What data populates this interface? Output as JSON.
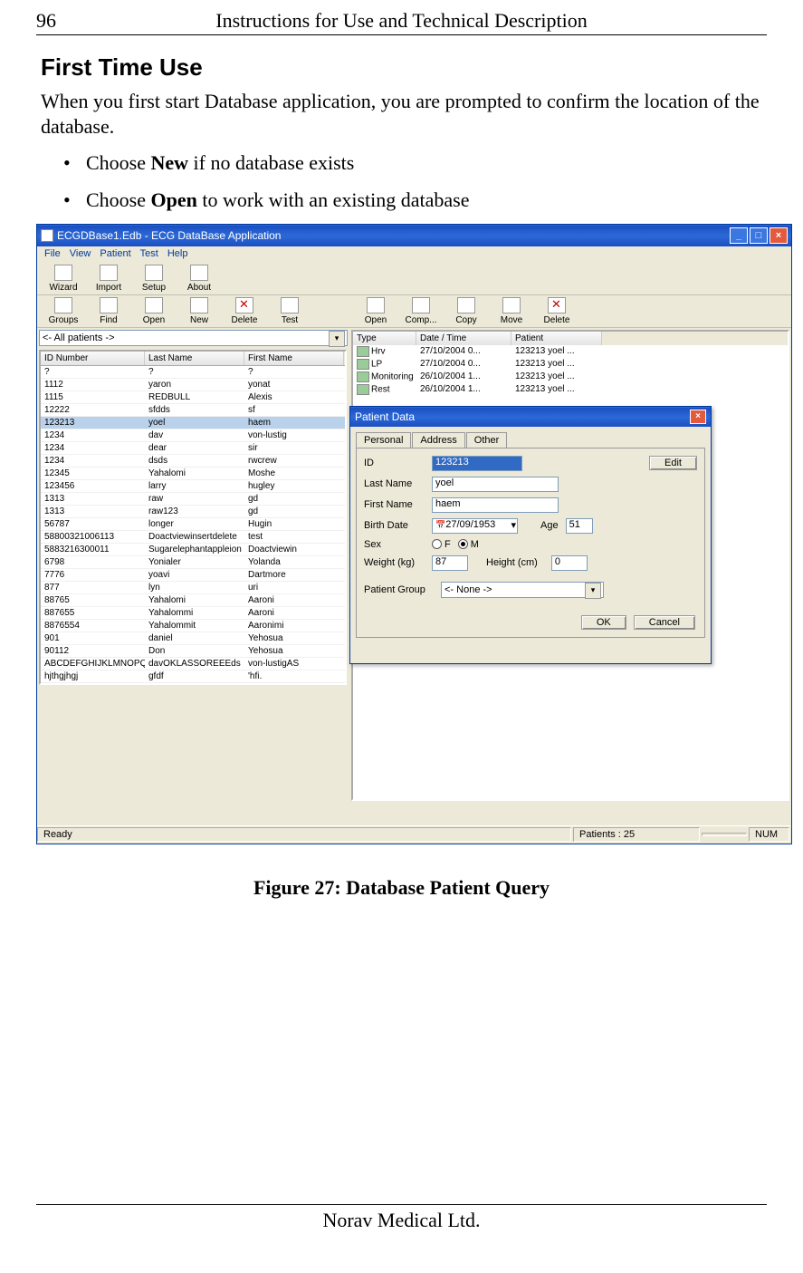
{
  "doc": {
    "page_number": "96",
    "running_head": "Instructions for Use and Technical Description",
    "section_heading": "First Time Use",
    "intro": "When you first start Database application, you are prompted to confirm the location of the database.",
    "bullets": [
      {
        "pre": "Choose ",
        "bold": "New",
        "post": " if no database exists"
      },
      {
        "pre": "Choose ",
        "bold": "Open",
        "post": " to work with an existing database"
      }
    ],
    "figure_caption": "Figure 27: Database Patient Query",
    "footer": "Norav Medical Ltd."
  },
  "app": {
    "title": "ECGDBase1.Edb - ECG DataBase Application",
    "menus": [
      "File",
      "View",
      "Patient",
      "Test",
      "Help"
    ],
    "toolbar1": [
      "Wizard",
      "Import",
      "Setup",
      "About"
    ],
    "toolbar2": [
      "Groups",
      "Find",
      "Open",
      "New",
      "Delete",
      "Test"
    ],
    "combo_value": "<- All patients ->",
    "left_headers": [
      "ID Number",
      "Last Name",
      "First Name"
    ],
    "left_rows": [
      [
        "?",
        "?",
        "?"
      ],
      [
        "1112",
        "yaron",
        "yonat"
      ],
      [
        "1115",
        "REDBULL",
        "Alexis"
      ],
      [
        "12222",
        "sfdds",
        "sf"
      ],
      [
        "123213",
        "yoel",
        "haem"
      ],
      [
        "1234",
        "dav",
        "von-lustig"
      ],
      [
        "1234",
        "dear",
        "sir"
      ],
      [
        "1234",
        "dsds",
        "rwcrew"
      ],
      [
        "12345",
        "Yahalomi",
        "Moshe"
      ],
      [
        "123456",
        "larry",
        "hugley"
      ],
      [
        "1313",
        "raw",
        "gd"
      ],
      [
        "1313",
        "raw123",
        "gd"
      ],
      [
        "56787",
        "longer",
        "Hugin"
      ],
      [
        "58800321006113",
        "Doactviewinsertdelete",
        "test"
      ],
      [
        "5883216300011",
        "Sugarelephantappleion",
        "Doactviewin"
      ],
      [
        "6798",
        "Yonialer",
        "Yolanda"
      ],
      [
        "7776",
        "yoavi",
        "Dartmore"
      ],
      [
        "877",
        "lyn",
        "uri"
      ],
      [
        "88765",
        "Yahalomi",
        "Aaroni"
      ],
      [
        "887655",
        "Yahalommi",
        "Aaroni"
      ],
      [
        "8876554",
        "Yahalommit",
        "Aaronimi"
      ],
      [
        "901",
        "daniel",
        "Yehosua"
      ],
      [
        "90112",
        "Don",
        "Yehosua"
      ],
      [
        "ABCDEFGHIJKLMNOPQ...",
        "davOKLASSOREEEds",
        "von-lustigAS"
      ],
      [
        "hjthgjhgj",
        "gfdf",
        "'hfi."
      ]
    ],
    "selected_row_index": 4,
    "right_toolbar": [
      "Open",
      "Comp...",
      "Copy",
      "Move",
      "Delete"
    ],
    "right_headers": [
      "Type",
      "Date / Time",
      "Patient"
    ],
    "right_rows": [
      [
        "Hrv",
        "27/10/2004 0...",
        "123213 yoel ..."
      ],
      [
        "LP",
        "27/10/2004 0...",
        "123213 yoel ..."
      ],
      [
        "Monitoring",
        "26/10/2004 1...",
        "123213 yoel ..."
      ],
      [
        "Rest",
        "26/10/2004 1...",
        "123213 yoel ..."
      ]
    ],
    "status_left": "Ready",
    "status_patients": "Patients :  25",
    "status_num": "NUM"
  },
  "dialog": {
    "title": "Patient Data",
    "tabs": [
      "Personal",
      "Address",
      "Other"
    ],
    "active_tab": 0,
    "labels": {
      "id": "ID",
      "last": "Last Name",
      "first": "First Name",
      "birth": "Birth Date",
      "age": "Age",
      "sex": "Sex",
      "weight": "Weight (kg)",
      "height": "Height (cm)",
      "group": "Patient Group"
    },
    "values": {
      "id": "123213",
      "last": "yoel",
      "first": "haem",
      "birth": "27/09/1953",
      "age": "51",
      "sex_f": "F",
      "sex_m": "M",
      "sex_checked": "M",
      "weight": "87",
      "height": "0",
      "group": "<- None ->"
    },
    "buttons": {
      "edit": "Edit",
      "ok": "OK",
      "cancel": "Cancel"
    }
  }
}
